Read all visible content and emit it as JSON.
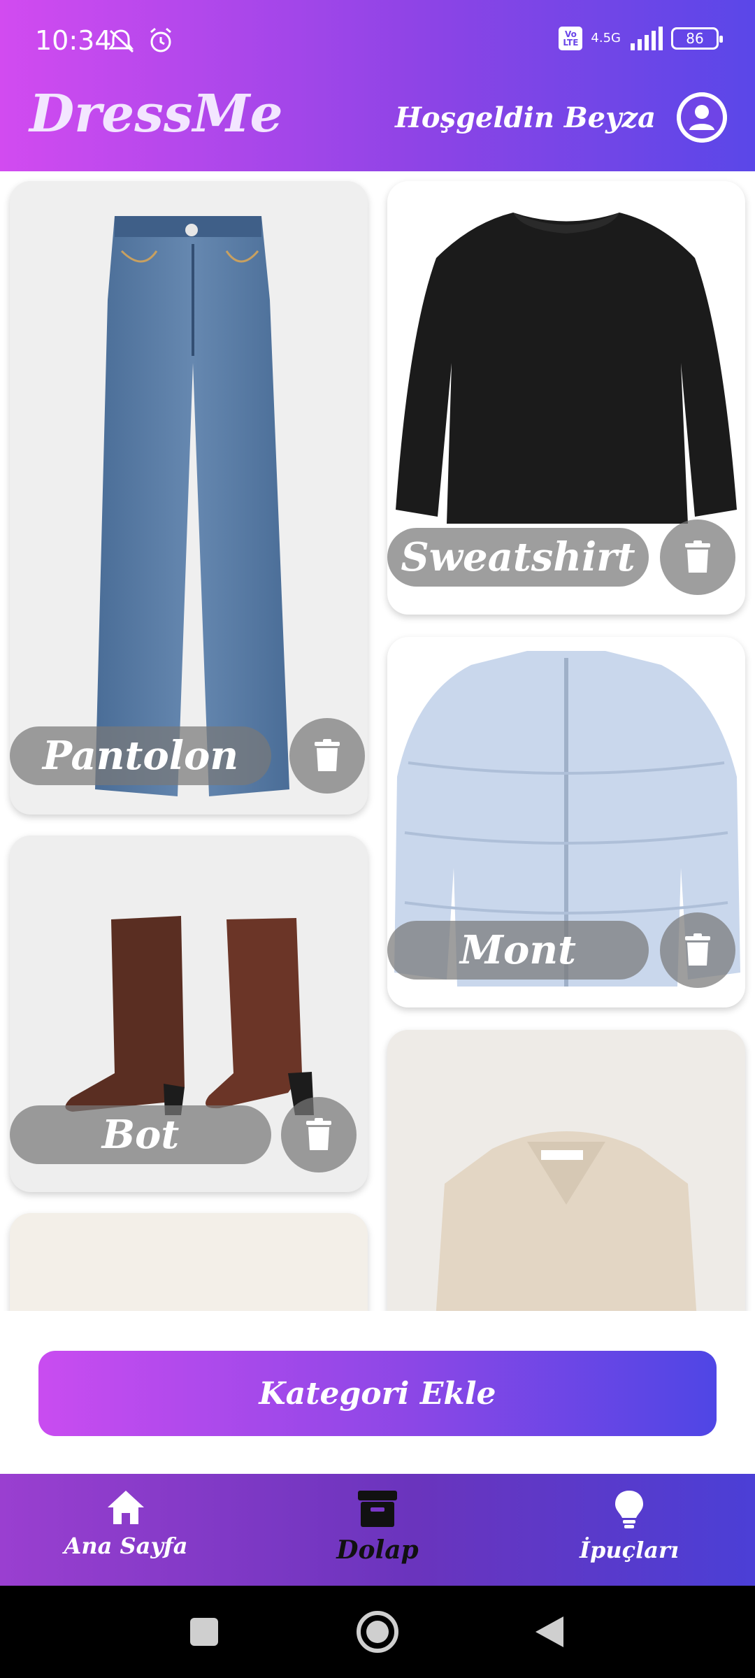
{
  "status_bar": {
    "time": "10:34",
    "network": "4.5G",
    "volte": "Vo LTE",
    "battery": "86"
  },
  "app_bar": {
    "title": "DressMe",
    "welcome": "Hoşgeldin Beyza"
  },
  "items": [
    {
      "label": "Pantolon",
      "icon": "jeans"
    },
    {
      "label": "Sweatshirt",
      "icon": "sweatshirt"
    },
    {
      "label": "Mont",
      "icon": "puffer-jacket"
    },
    {
      "label": "Bot",
      "icon": "boots"
    }
  ],
  "add_button": {
    "label": "Kategori Ekle"
  },
  "bottom_nav": {
    "items": [
      {
        "label": "Ana Sayfa",
        "icon": "home-icon"
      },
      {
        "label": "Dolap",
        "icon": "wardrobe-icon",
        "active": true
      },
      {
        "label": "İpuçları",
        "icon": "lightbulb-icon"
      }
    ]
  },
  "colors": {
    "gradient_start": "#d24bf0",
    "gradient_end": "#4f46e5",
    "label_bg": "#787878"
  }
}
